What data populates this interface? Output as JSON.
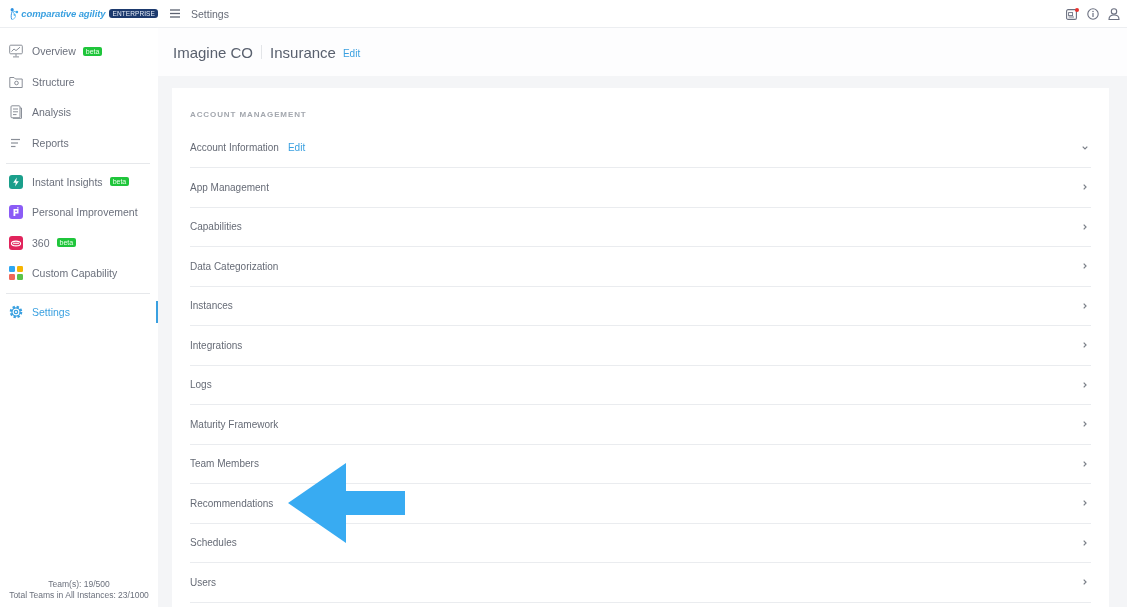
{
  "logo": {
    "text": "comparative agility",
    "badge": "ENTERPRISE"
  },
  "topbar": {
    "title": "Settings",
    "notification_dot": true
  },
  "sidebar": {
    "groups": [
      {
        "items": [
          {
            "label": "Overview",
            "badge": "beta",
            "selected": false
          },
          {
            "label": "Structure",
            "selected": false
          },
          {
            "label": "Analysis",
            "selected": false
          },
          {
            "label": "Reports",
            "selected": false
          }
        ]
      },
      {
        "items": [
          {
            "label": "Instant Insights",
            "badge": "beta",
            "selected": false
          },
          {
            "label": "Personal Improvement",
            "selected": false
          },
          {
            "label": "360",
            "badge": "beta",
            "selected": false
          },
          {
            "label": "Custom Capability",
            "selected": false
          }
        ]
      },
      {
        "items": [
          {
            "label": "Settings",
            "selected": true
          }
        ]
      }
    ],
    "footer": [
      "Team(s): 19/500",
      "Total Teams in All Instances: 23/1000"
    ]
  },
  "header": {
    "organization": "Imagine CO",
    "division": "Insurance",
    "edit_link": "Edit"
  },
  "account_management": {
    "title": "ACCOUNT MANAGEMENT",
    "rows": [
      {
        "label": "Account Information",
        "edit_link": "Edit",
        "expanded": true,
        "pointed_at": false
      },
      {
        "label": "App Management",
        "expanded": false,
        "pointed_at": false
      },
      {
        "label": "Capabilities",
        "expanded": false,
        "pointed_at": false
      },
      {
        "label": "Data Categorization",
        "expanded": false,
        "pointed_at": false
      },
      {
        "label": "Instances",
        "expanded": false,
        "pointed_at": false
      },
      {
        "label": "Integrations",
        "expanded": false,
        "pointed_at": false
      },
      {
        "label": "Logs",
        "expanded": false,
        "pointed_at": false
      },
      {
        "label": "Maturity Framework",
        "expanded": false,
        "pointed_at": false
      },
      {
        "label": "Team Members",
        "expanded": false,
        "pointed_at": false
      },
      {
        "label": "Recommendations",
        "expanded": false,
        "pointed_at": true
      },
      {
        "label": "Schedules",
        "expanded": false,
        "pointed_at": false
      },
      {
        "label": "Users",
        "expanded": false,
        "pointed_at": false
      }
    ]
  }
}
